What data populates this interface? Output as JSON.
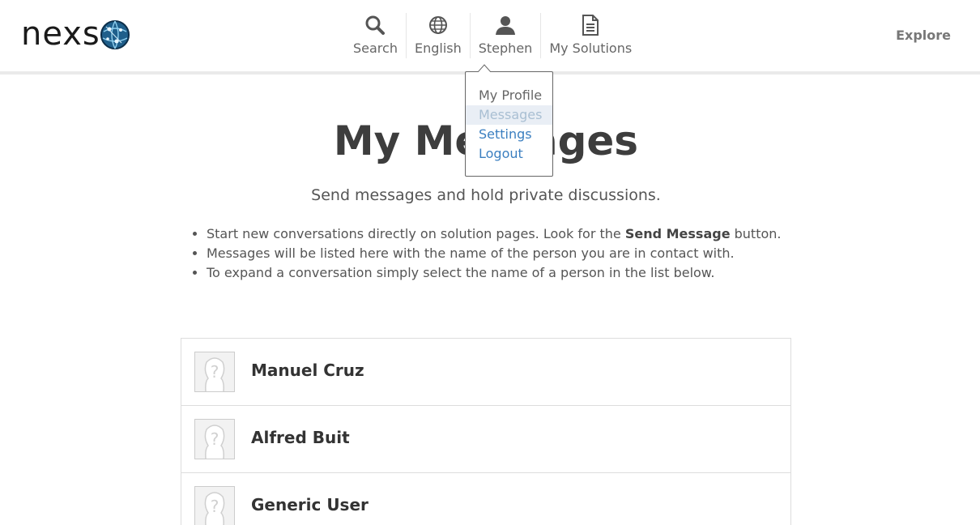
{
  "brand": {
    "logo_text": "nexs"
  },
  "nav": {
    "search_label": "Search",
    "language_label": "English",
    "user_label": "Stephen",
    "solutions_label": "My Solutions",
    "explore_label": "Explore"
  },
  "dropdown": {
    "items": [
      "My Profile",
      "Messages",
      "Settings",
      "Logout"
    ],
    "active": "Messages"
  },
  "main": {
    "title": "My Messages",
    "subtitle": "Send messages and hold private discussions.",
    "tips": {
      "first_before": "Start new conversations directly on solution pages. Look for the ",
      "first_bold": "Send Message",
      "first_after": " button.",
      "second": "Messages will be listed here with the name of the person you are in contact with.",
      "third": "To expand a conversation simply select the name of a person in the list below."
    }
  },
  "conversations": [
    {
      "name": "Manuel Cruz"
    },
    {
      "name": "Alfred Buit"
    },
    {
      "name": "Generic User"
    }
  ],
  "colors": {
    "link": "#3b7fc0",
    "active_item_text": "#a9bfd3",
    "active_item_bg": "#e9eef5",
    "globe_blue": "#1f5f8b"
  },
  "icons": [
    "search-icon",
    "globe-icon",
    "user-icon",
    "document-icon",
    "placeholder-avatar-icon"
  ]
}
